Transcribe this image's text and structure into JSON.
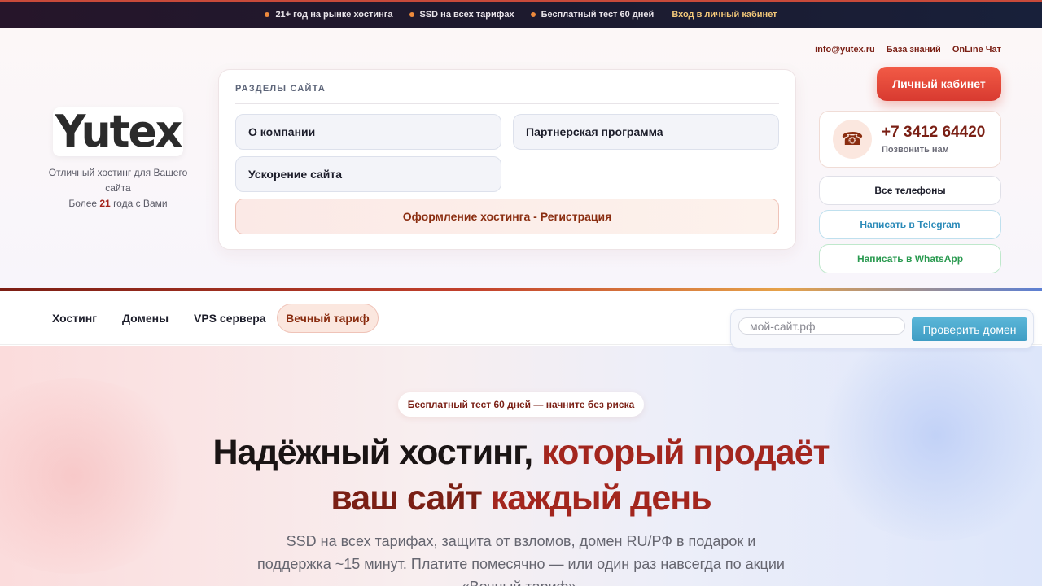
{
  "topbar": {
    "items": [
      "21+ год на рынке хостинга",
      "SSD на всех тарифах",
      "Бесплатный тест 60 дней"
    ],
    "login_link": "Вход в личный кабинет"
  },
  "brand": {
    "logo_text": "Yutex",
    "tagline_line1": "Отличный хостинг для Вашего сайта",
    "tagline_prefix": "Более ",
    "tagline_years": "21",
    "tagline_suffix": " года с Вами"
  },
  "sections": {
    "title": "РАЗДЕЛЫ САЙТА",
    "items": [
      "О компании",
      "Партнерская программа",
      "Ускорение сайта"
    ],
    "register_label": "Оформление хостинга - Регистрация"
  },
  "contacts": {
    "email": "info@yutex.ru",
    "knowledge_base": "База знаний",
    "online_chat": "OnLine Чат",
    "cabinet_button": "Личный кабинет",
    "phone": "+7 3412 64420",
    "phone_sub": "Позвонить нам",
    "all_phones": "Все телефоны",
    "telegram": "Написать в Telegram",
    "whatsapp": "Написать в WhatsApp"
  },
  "nav": {
    "items": [
      "Хостинг",
      "Домены",
      "VPS сервера"
    ],
    "highlight": "Вечный тариф"
  },
  "domain_check": {
    "placeholder": "мой-сайт.рф",
    "button": "Проверить домен"
  },
  "hero": {
    "badge": "Бесплатный тест 60 дней — начните без риска",
    "title_part1": "Надёжный хостинг, ",
    "title_part2": "который продаёт",
    "title_part3": "ваш сайт ",
    "title_part4": "каждый день",
    "text": "SSD на всех тарифах, защита от взломов, домен RU/РФ в подарок и поддержка ~15 минут. Платите помесячно — или один раз навсегда по акции «Вечный тариф»."
  },
  "colors": {
    "accent": "#a3261e",
    "cabinet_button": "#e5463a",
    "telegram": "#2a8ab8",
    "whatsapp": "#2a9a50"
  }
}
